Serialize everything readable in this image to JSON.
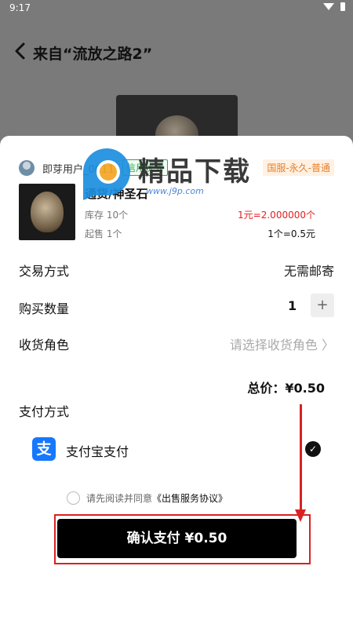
{
  "status_bar": {
    "time": "9:17"
  },
  "header": {
    "title": "来自“流放之路2”"
  },
  "seller": {
    "name": "即芽用户_0011",
    "credit_badge": "信用优秀",
    "server_badge": "国服-永久-普通"
  },
  "item": {
    "name": "通货/神圣石",
    "stock": "库存 10个",
    "min_sale": "起售 1个",
    "rate_a": "1元=2.000000个",
    "rate_b": "1个=0.5元"
  },
  "trade": {
    "method_label": "交易方式",
    "method_value": "无需邮寄",
    "quantity_label": "购买数量",
    "quantity_value": "1",
    "plus_label": "+",
    "role_label": "收货角色",
    "role_placeholder": "请选择收货角色 〉"
  },
  "total": {
    "text": "总价：¥0.50"
  },
  "payment": {
    "section_label": "支付方式",
    "alipay_icon_text": "支",
    "alipay_label": "支付宝支付",
    "selected_mark": "✓"
  },
  "agreement": {
    "prefix": "请先阅读并同意",
    "link": "《出售服务协议》"
  },
  "confirm": {
    "label": "确认支付 ¥0.50"
  },
  "watermark": {
    "title": "精品下载",
    "url": "www.j9p.com"
  },
  "colors": {
    "accent_red": "#e31e1e",
    "credit_green": "#2fa84f",
    "server_orange": "#e8802a",
    "alipay_blue": "#1677ff",
    "annotation_red": "#d92121"
  }
}
